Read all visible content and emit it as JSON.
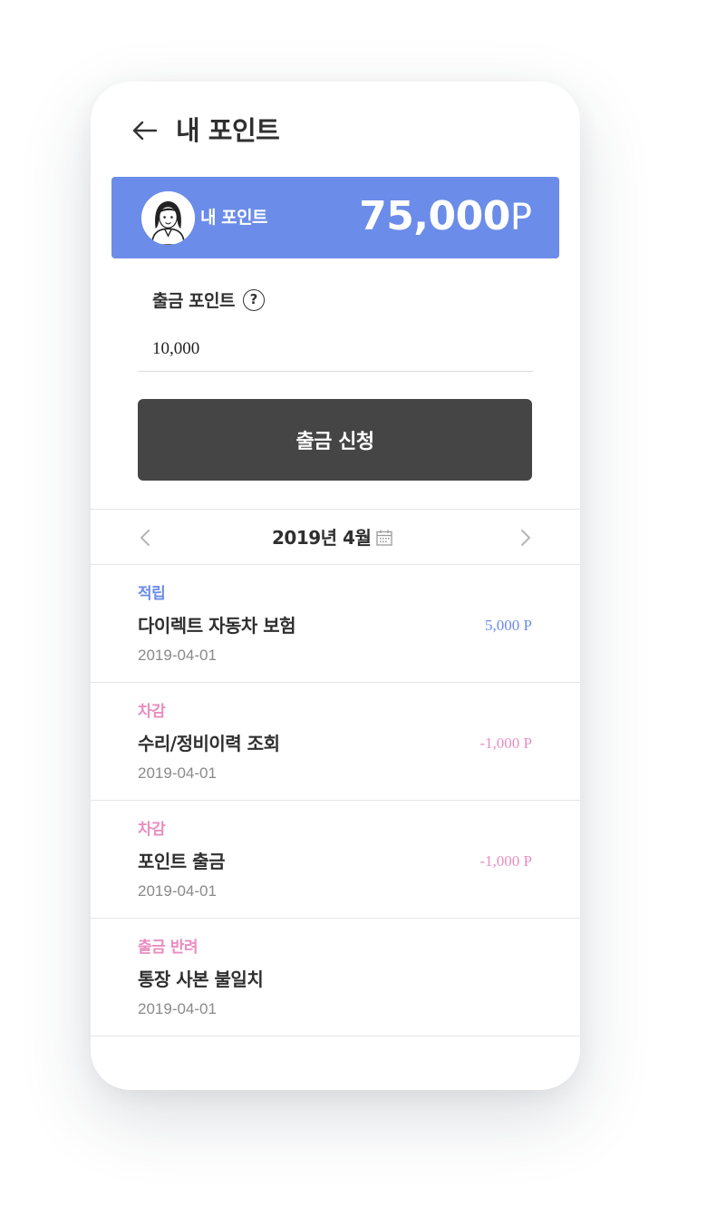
{
  "header": {
    "title": "내 포인트"
  },
  "banner": {
    "label": "내 포인트",
    "amount": "75,000",
    "unit": "P"
  },
  "withdraw": {
    "label": "출금 포인트",
    "help": "?",
    "value": "10,000",
    "button": "출금 신청"
  },
  "month_nav": {
    "label": "2019년 4월"
  },
  "transactions": [
    {
      "type": "적립",
      "title": "다이렉트 자동차 보험",
      "date": "2019-04-01",
      "amount": "5,000 P"
    },
    {
      "type": "차감",
      "title": "수리/정비이력 조회",
      "date": "2019-04-01",
      "amount": "-1,000 P"
    },
    {
      "type": "차감",
      "title": "포인트 출금",
      "date": "2019-04-01",
      "amount": "-1,000 P"
    },
    {
      "type": "출금 반려",
      "title": "통장 사본 불일치",
      "date": "2019-04-01",
      "amount": ""
    }
  ],
  "colors": {
    "accent": "#6b8ce8",
    "deduct": "#ea8dbf",
    "button": "#454545",
    "text": "#2f2f2f"
  },
  "icons": {
    "back": "arrow-left-icon",
    "avatar": "user-avatar-icon",
    "help": "question-circle-icon",
    "prev": "chevron-left-icon",
    "next": "chevron-right-icon",
    "calendar": "calendar-icon"
  }
}
